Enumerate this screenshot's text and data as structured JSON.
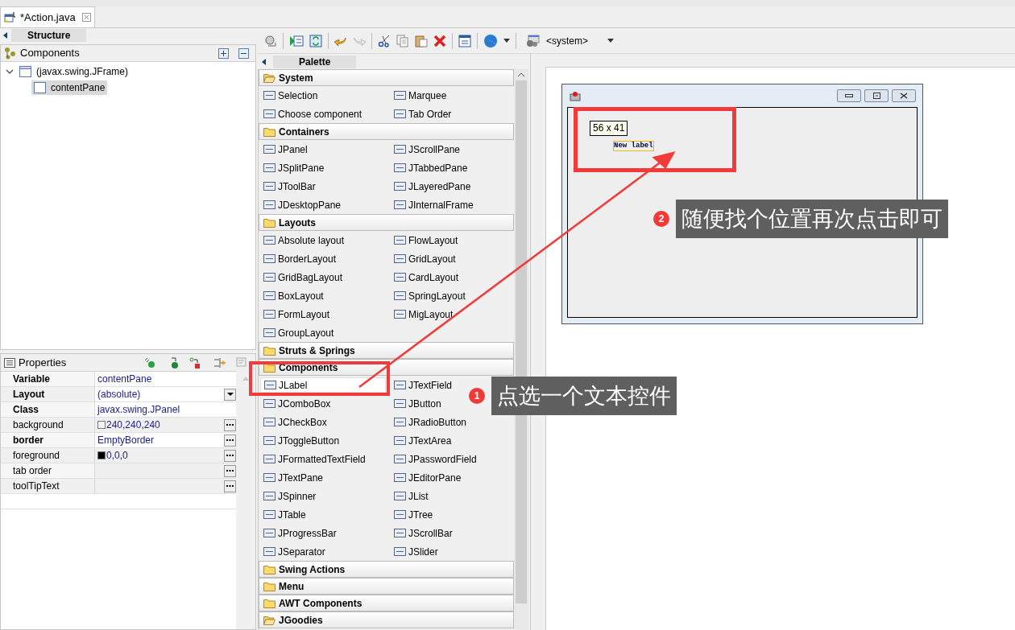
{
  "editor_tab": {
    "title": "*Action.java"
  },
  "structure": {
    "title": "Structure",
    "components_label": "Components",
    "tree": [
      {
        "label": "(javax.swing.JFrame)",
        "expanded": true,
        "selected": false,
        "children": [
          {
            "label": "contentPane",
            "selected": true
          }
        ]
      }
    ]
  },
  "properties": {
    "title": "Properties",
    "rows": [
      {
        "name": "Variable",
        "value": "contentPane",
        "bold": true,
        "kind": "text"
      },
      {
        "name": "Layout",
        "value": "(absolute)",
        "bold": true,
        "kind": "dropdown"
      },
      {
        "name": "Class",
        "value": "javax.swing.JPanel",
        "bold": true,
        "kind": "text"
      },
      {
        "name": "background",
        "value": "240,240,240",
        "bold": false,
        "kind": "color",
        "color": "#f0f0f0"
      },
      {
        "name": "border",
        "value": "EmptyBorder",
        "bold": true,
        "kind": "dialog"
      },
      {
        "name": "foreground",
        "value": "0,0,0",
        "bold": false,
        "kind": "color",
        "color": "#000000"
      },
      {
        "name": "tab order",
        "bold": false,
        "kind": "dialog"
      },
      {
        "name": "toolTipText",
        "bold": false,
        "kind": "dialog"
      }
    ]
  },
  "toolbar": {
    "system_label": "<system>"
  },
  "palette": {
    "title": "Palette",
    "categories": [
      {
        "label": "System",
        "expanded": true,
        "items": [
          {
            "label": "Selection",
            "selected": false
          },
          {
            "label": "Marquee",
            "selected": false
          },
          {
            "label": "Choose component",
            "selected": false
          },
          {
            "label": "Tab Order",
            "selected": false
          }
        ]
      },
      {
        "label": "Containers",
        "expanded": false,
        "items": [
          {
            "label": "JPanel",
            "selected": false
          },
          {
            "label": "JScrollPane",
            "selected": false
          },
          {
            "label": "JSplitPane",
            "selected": false
          },
          {
            "label": "JTabbedPane",
            "selected": false
          },
          {
            "label": "JToolBar",
            "selected": false
          },
          {
            "label": "JLayeredPane",
            "selected": false
          },
          {
            "label": "JDesktopPane",
            "selected": false
          },
          {
            "label": "JInternalFrame",
            "selected": false
          }
        ]
      },
      {
        "label": "Layouts",
        "expanded": false,
        "items": [
          {
            "label": "Absolute layout",
            "selected": false
          },
          {
            "label": "FlowLayout",
            "selected": false
          },
          {
            "label": "BorderLayout",
            "selected": false
          },
          {
            "label": "GridLayout",
            "selected": false
          },
          {
            "label": "GridBagLayout",
            "selected": false
          },
          {
            "label": "CardLayout",
            "selected": false
          },
          {
            "label": "BoxLayout",
            "selected": false
          },
          {
            "label": "SpringLayout",
            "selected": false
          },
          {
            "label": "FormLayout",
            "selected": false
          },
          {
            "label": "MigLayout",
            "selected": false
          },
          {
            "label": "GroupLayout",
            "selected": false
          }
        ]
      },
      {
        "label": "Struts & Springs",
        "expanded": false
      },
      {
        "label": "Components",
        "expanded": false,
        "items": [
          {
            "label": "JLabel",
            "selected": true
          },
          {
            "label": "JTextField",
            "selected": false
          },
          {
            "label": "JComboBox",
            "selected": false
          },
          {
            "label": "JButton",
            "selected": false
          },
          {
            "label": "JCheckBox",
            "selected": false
          },
          {
            "label": "JRadioButton",
            "selected": false
          },
          {
            "label": "JToggleButton",
            "selected": false
          },
          {
            "label": "JTextArea",
            "selected": false
          },
          {
            "label": "JFormattedTextField",
            "selected": false
          },
          {
            "label": "JPasswordField",
            "selected": false
          },
          {
            "label": "JTextPane",
            "selected": false
          },
          {
            "label": "JEditorPane",
            "selected": false
          },
          {
            "label": "JSpinner",
            "selected": false
          },
          {
            "label": "JList",
            "selected": false
          },
          {
            "label": "JTable",
            "selected": false
          },
          {
            "label": "JTree",
            "selected": false
          },
          {
            "label": "JProgressBar",
            "selected": false
          },
          {
            "label": "JScrollBar",
            "selected": false
          },
          {
            "label": "JSeparator",
            "selected": false
          },
          {
            "label": "JSlider",
            "selected": false
          }
        ]
      },
      {
        "label": "Swing Actions",
        "expanded": false
      },
      {
        "label": "Menu",
        "expanded": false
      },
      {
        "label": "AWT Components",
        "expanded": false
      },
      {
        "label": "JGoodies",
        "expanded": true
      }
    ]
  },
  "design": {
    "size_tooltip": "56 x 41",
    "label_text": "New label"
  },
  "annotations": [
    {
      "number": "1",
      "text": "点选一个文本控件"
    },
    {
      "number": "2",
      "text": "随便找个位置再次点击即可"
    }
  ]
}
